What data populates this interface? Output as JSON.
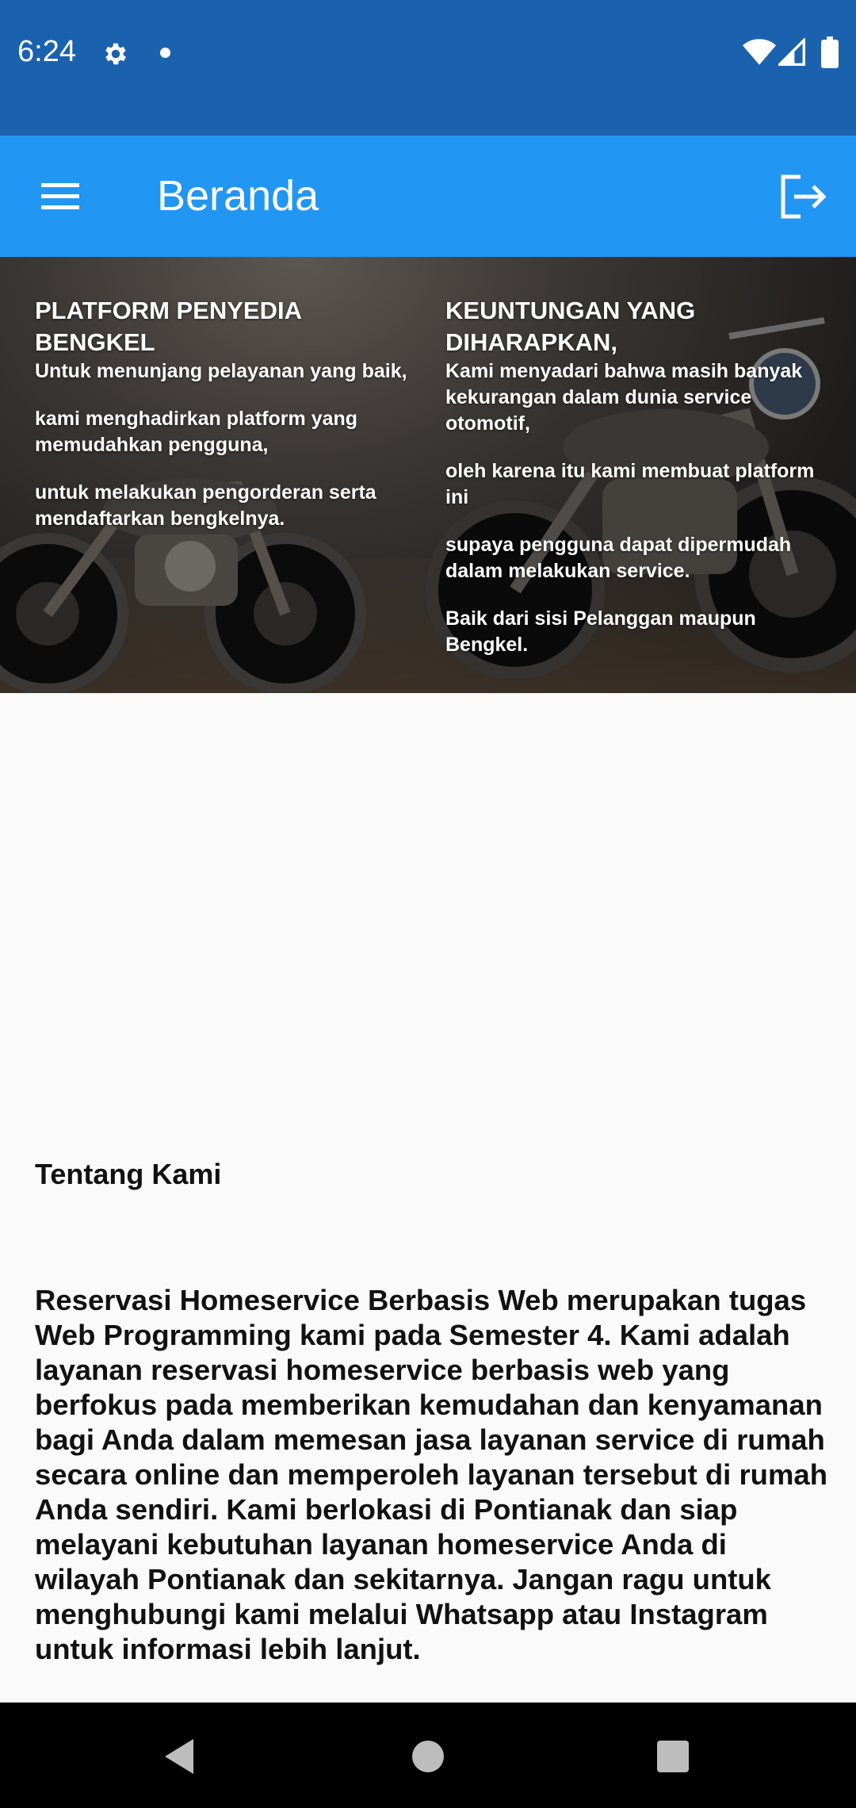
{
  "status_bar": {
    "time": "6:24",
    "icons": [
      "settings-icon",
      "notification-dot-icon",
      "wifi-icon",
      "cell-signal-icon",
      "battery-icon"
    ],
    "background": "#1a62ae"
  },
  "app_bar": {
    "title": "Beranda",
    "menu_icon": "hamburger-menu-icon",
    "action_icon": "logout-icon",
    "background": "#2196f3"
  },
  "hero": {
    "image": "motorcycles-in-dark-garage",
    "left": {
      "heading": "PLATFORM PENYEDIA BENGKEL",
      "paragraphs": [
        "Untuk menunjang pelayanan yang baik,",
        "kami menghadirkan platform yang memudahkan pengguna,",
        "untuk melakukan pengorderan serta mendaftarkan bengkelnya."
      ]
    },
    "right": {
      "heading": "KEUNTUNGAN YANG DIHARAPKAN,",
      "paragraphs": [
        "Kami menyadari bahwa masih banyak kekurangan dalam dunia service otomotif,",
        "oleh karena itu kami membuat platform ini",
        "supaya pengguna dapat dipermudah dalam melakukan service.",
        "Baik dari sisi Pelanggan maupun Bengkel."
      ]
    }
  },
  "about": {
    "title": "Tentang Kami",
    "text": "Reservasi Homeservice Berbasis Web merupakan tugas Web Programming kami pada Semester 4. Kami adalah layanan reservasi homeservice berbasis web yang berfokus pada memberikan kemudahan dan kenyamanan bagi Anda dalam memesan jasa layanan service di rumah secara online dan memperoleh layanan tersebut di rumah Anda sendiri. Kami berlokasi di Pontianak dan siap melayani kebutuhan layanan homeservice Anda di wilayah Pontianak dan sekitarnya. Jangan ragu untuk menghubungi kami melalui Whatsapp atau Instagram untuk informasi lebih lanjut."
  },
  "nav_bar": {
    "icons": [
      "back-icon",
      "home-icon",
      "recent-apps-icon"
    ]
  }
}
